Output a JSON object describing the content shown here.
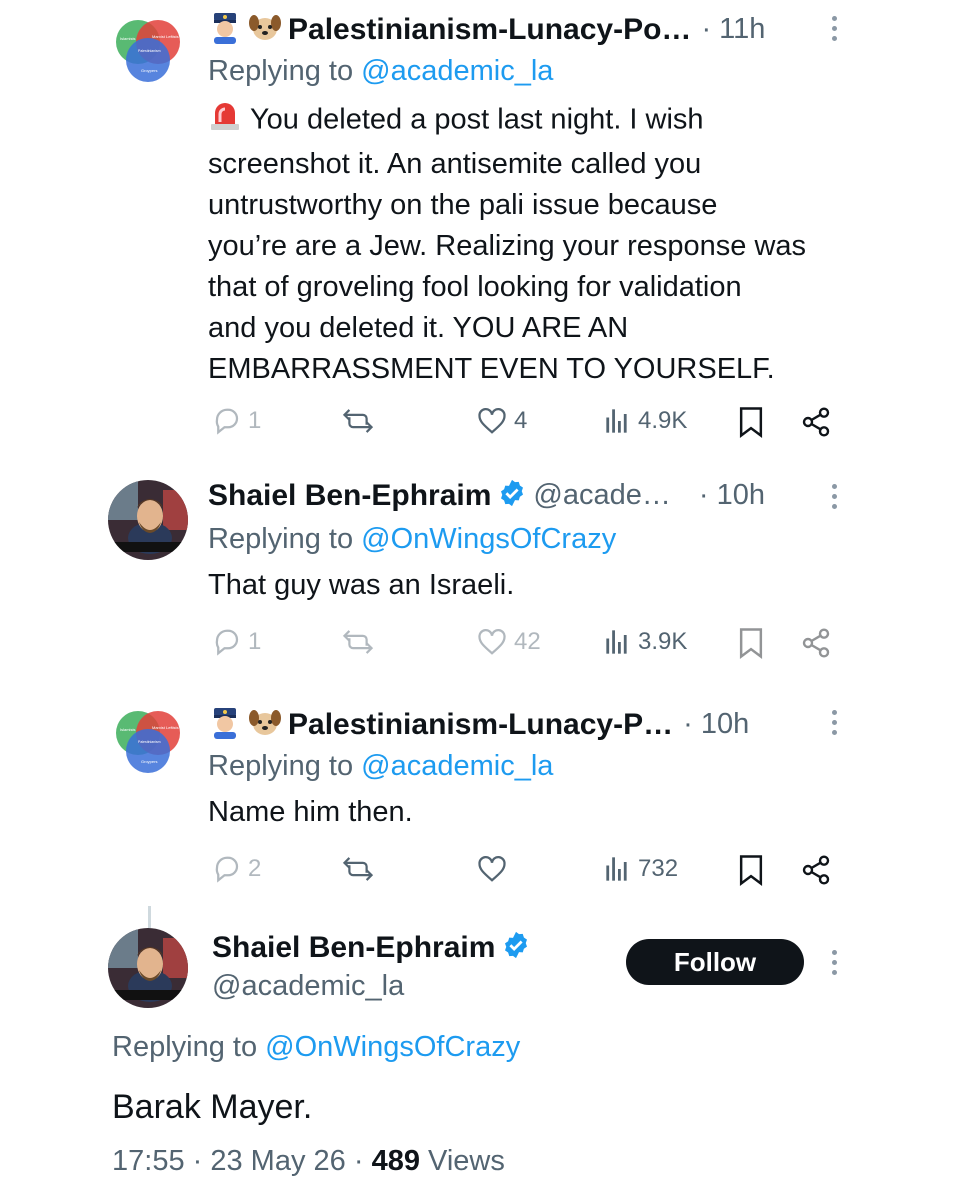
{
  "tweets": [
    {
      "author_name": "Palestinianism-Lunacy-Po…",
      "time": "· 11h",
      "replying_prefix": "Replying to ",
      "replying_to": "@academic_la",
      "text_lines": [
        "You deleted a post last night. I wish",
        "screenshot it. An antisemite called you",
        "untrustworthy on the pali issue because",
        "you’re are a Jew. Realizing your response was",
        "that of groveling fool looking for validation",
        "and you deleted it. YOU ARE AN",
        "EMBARRASSMENT EVEN TO YOURSELF."
      ],
      "replies": "1",
      "likes": "4",
      "views": "4.9K"
    },
    {
      "author_name": "Shaiel Ben-Ephraim",
      "handle": "@acade…",
      "time": "· 10h",
      "replying_prefix": "Replying to ",
      "replying_to": "@OnWingsOfCrazy",
      "text": "That guy was an Israeli.",
      "replies": "1",
      "likes": "42",
      "views": "3.9K"
    },
    {
      "author_name": "Palestinianism-Lunacy-P…",
      "time": "· 10h",
      "replying_prefix": "Replying to ",
      "replying_to": "@academic_la",
      "text": "Name him then.",
      "replies": "2",
      "likes": "",
      "views": "732"
    }
  ],
  "main_tweet": {
    "author_name": "Shaiel Ben-Ephraim",
    "handle": "@academic_la",
    "follow_label": "Follow",
    "replying_prefix": "Replying to ",
    "replying_to": "@OnWingsOfCrazy",
    "text": "Barak Mayer.",
    "time": "17:55",
    "date": "23 May 26",
    "views_count": "489",
    "views_label": "Views"
  },
  "avatar_labels": {
    "circle_left": "Islamists",
    "circle_right": "Marxist Leftists",
    "center": "Palestinianism",
    "circle_bottom": "Groypers"
  },
  "colors": {
    "accent": "#1d9bf0",
    "text": "#0f1419",
    "muted": "#536471",
    "button_bg": "#0f1419"
  },
  "icons": [
    "police-emoji-icon",
    "dog-emoji-icon",
    "siren-emoji-icon",
    "verified-badge-icon",
    "reply-icon",
    "retweet-icon",
    "like-icon",
    "views-icon",
    "bookmark-icon",
    "share-icon",
    "more-dots-icon"
  ]
}
